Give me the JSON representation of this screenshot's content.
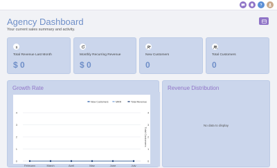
{
  "header": {
    "title": "Agency Dashboard",
    "subtitle": "Your current sales summary and activity."
  },
  "topbar": {
    "icons": [
      "message-icon",
      "bell-icon",
      "help-icon",
      "user-avatar"
    ],
    "colors": [
      "#8f74c7",
      "#8f74c7",
      "#5b8fd6",
      "#c9a98c"
    ]
  },
  "stats": [
    {
      "label": "Total Revenue Last Month",
      "value": "$ 0",
      "icon": "dollar-icon"
    },
    {
      "label": "Monthly Recurring Revenue",
      "value": "$ 0",
      "icon": "refresh-icon"
    },
    {
      "label": "New Customers",
      "value": "0",
      "icon": "user-plus-icon"
    },
    {
      "label": "Total Customers",
      "value": "0",
      "icon": "users-icon"
    }
  ],
  "growth": {
    "title": "Growth Rate"
  },
  "distribution": {
    "title": "Revenue Distribution",
    "empty_text": "No data to display"
  },
  "colors": {
    "accent": "#8f74c7",
    "value": "#6f8fc8",
    "card": "#cbd6ec",
    "series_new": "#2e5fa7",
    "series_mrr": "#7ea6d9",
    "series_total": "#1f3f74"
  },
  "chart_data": {
    "type": "line",
    "categories": [
      "February",
      "March",
      "April",
      "May",
      "June",
      "July"
    ],
    "series": [
      {
        "name": "New Customers",
        "values": [
          0,
          0,
          0,
          0,
          0,
          0
        ]
      },
      {
        "name": "MRR",
        "values": [
          0,
          0,
          0,
          0,
          0,
          0
        ]
      },
      {
        "name": "Total Revenue",
        "values": [
          0,
          0,
          0,
          0,
          0,
          0
        ]
      }
    ],
    "y_ticks": [
      "0",
      "1",
      "2",
      "3",
      "4"
    ],
    "y2_ticks": [
      "0",
      "1",
      "2",
      "3",
      "4"
    ],
    "y2label": "Total Customers",
    "ylim": [
      0,
      4
    ],
    "legend": "top-right",
    "grid": true
  }
}
